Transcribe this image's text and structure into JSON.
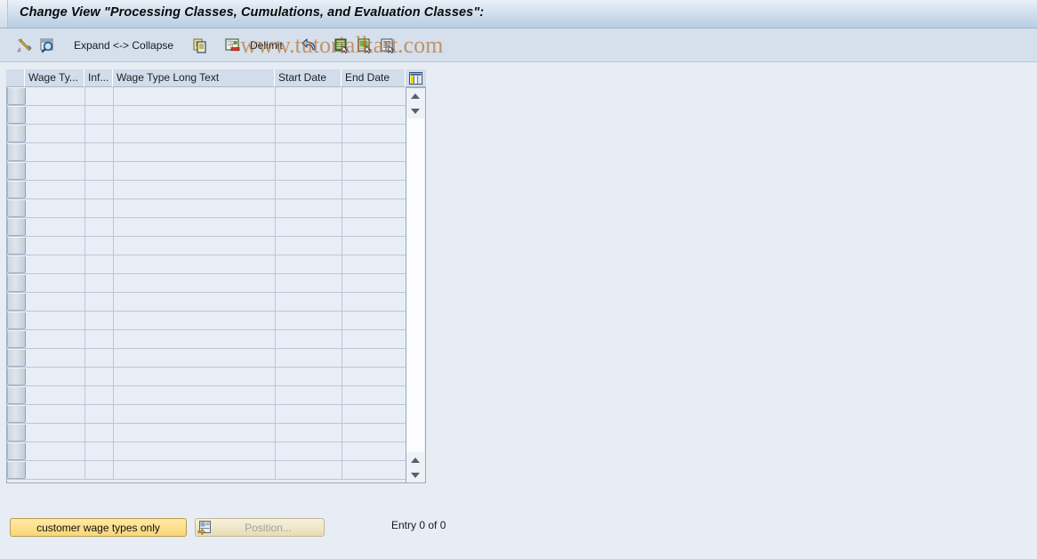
{
  "window": {
    "title": "Change View \"Processing Classes, Cumulations, and Evaluation Classes\":"
  },
  "toolbar": {
    "items": [
      {
        "name": "edit-pencil-icon",
        "icon": "pencil-icon",
        "label": ""
      },
      {
        "name": "display-check-icon",
        "icon": "magnifier-icon",
        "label": ""
      },
      {
        "name": "expand-collapse",
        "icon": "",
        "label": "Expand <-> Collapse"
      },
      {
        "name": "copy-button",
        "icon": "copy-pages-icon",
        "label": ""
      },
      {
        "name": "delimit-icon-btn",
        "icon": "delimit-doc-icon",
        "label": ""
      },
      {
        "name": "delimit-button",
        "icon": "",
        "label": "Delimit"
      },
      {
        "name": "undo-button",
        "icon": "undo-arrow-icon",
        "label": ""
      },
      {
        "name": "select-all-button",
        "icon": "select-all-icon",
        "label": ""
      },
      {
        "name": "deselect-all-button",
        "icon": "deselect-all-icon",
        "label": ""
      },
      {
        "name": "details-button",
        "icon": "details-doc-icon",
        "label": ""
      }
    ],
    "expand_collapse_label": "Expand <-> Collapse",
    "delimit_label": "Delimit"
  },
  "watermark": {
    "copyright": "©",
    "text": "www.tutorialkart.com",
    "color": "#b5651d"
  },
  "table": {
    "columns": [
      {
        "key": "select",
        "label": ""
      },
      {
        "key": "wage_type",
        "label": "Wage Ty..."
      },
      {
        "key": "infotype",
        "label": "Inf..."
      },
      {
        "key": "long_text",
        "label": "Wage Type Long Text"
      },
      {
        "key": "start_date",
        "label": "Start Date"
      },
      {
        "key": "end_date",
        "label": "End Date"
      }
    ],
    "config_icon": "table-settings-icon",
    "rows": [],
    "empty_row_count": 21,
    "scrollbar": {
      "up_arrow_icon": "arrow-up-icon",
      "down_arrow_icon": "arrow-down-icon"
    }
  },
  "footer": {
    "customer_wage_types_label": "customer wage types only",
    "position_label": "Position...",
    "position_icon": "position-jump-icon",
    "entry_count": "Entry 0 of 0"
  },
  "colors": {
    "background": "#e8edf5",
    "titlebar_top": "#e9f0f8",
    "titlebar_bottom": "#b9cde2",
    "toolbar": "#d5e0ec",
    "header_cell": "#d3dcea",
    "row_cell": "#e9eef6",
    "grid_line": "#bac7d8",
    "accent_yellow": "#fde08c",
    "watermark": "#b5651d"
  }
}
